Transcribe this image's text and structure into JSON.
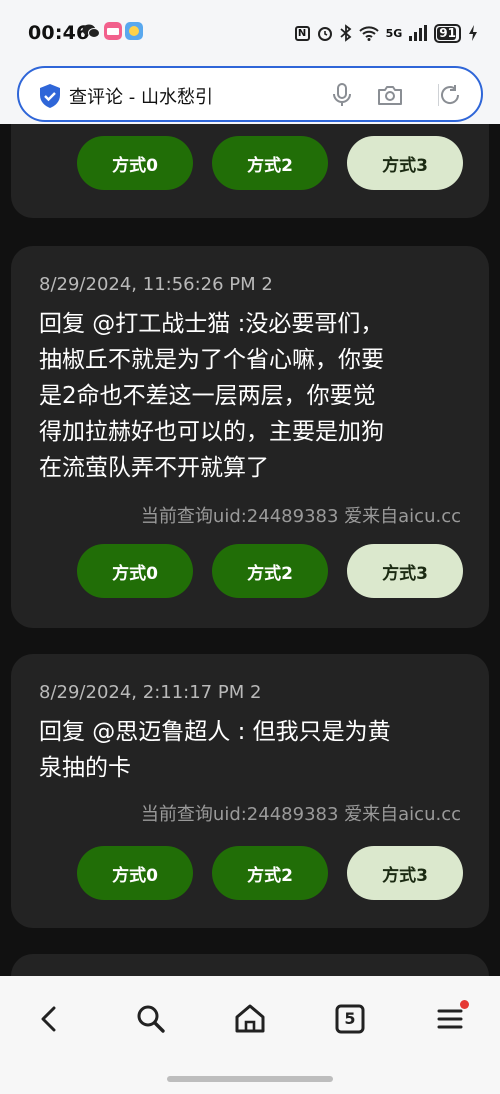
{
  "status_bar": {
    "time": "00:46",
    "network": "5G",
    "battery": "91",
    "battery_level": 0.91
  },
  "address_bar": {
    "title": "查评论 - 山水愁引",
    "icons": [
      "shield-check-icon",
      "microphone-icon",
      "camera-icon",
      "refresh-icon"
    ]
  },
  "partial_card": {
    "buttons": [
      "方式0",
      "方式2",
      "方式3"
    ]
  },
  "cards": [
    {
      "timestamp": "8/29/2024, 11:56:26 PM 2",
      "lines": [
        "回复 @打工战士猫 :没必要哥们，",
        "抽椒丘不就是为了个省心嘛，你要",
        "是2命也不差这一层两层，你要觉",
        "得加拉赫好也可以的，主要是加狗",
        "在流萤队弄不开就算了"
      ],
      "uid_line": "当前查询uid:24489383 爱来自aicu.cc",
      "buttons": [
        "方式0",
        "方式2",
        "方式3"
      ]
    },
    {
      "timestamp": "8/29/2024, 2:11:17 PM 2",
      "lines": [
        "回复 @思迈鲁超人 : 但我只是为黄",
        "泉抽的卡"
      ],
      "uid_line": "当前查询uid:24489383 爱来自aicu.cc",
      "buttons": [
        "方式0",
        "方式2",
        "方式3"
      ]
    }
  ],
  "bottom_nav": {
    "tab_count": "5",
    "items": [
      "back-icon",
      "search-icon",
      "home-icon",
      "tabs-icon",
      "menu-icon"
    ]
  },
  "colors": {
    "page_bg": "#111111",
    "card_bg": "#232323",
    "button_green": "#216e07",
    "button_light": "#dbe8cd",
    "address_border": "#2f66d8",
    "notification_dot": "#e53935"
  }
}
